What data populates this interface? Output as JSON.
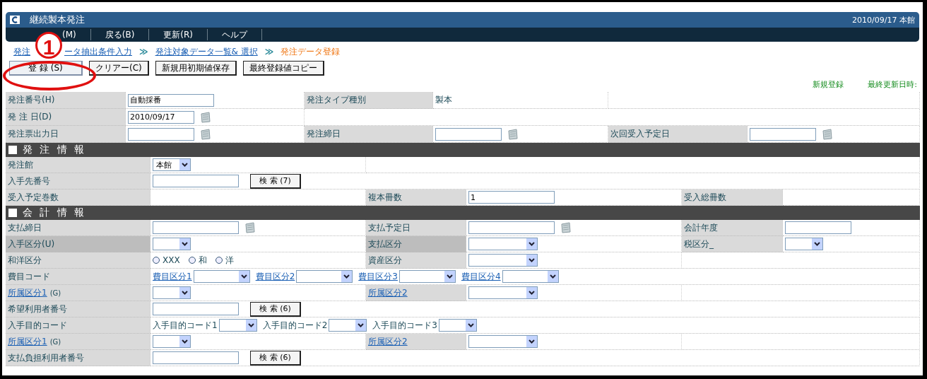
{
  "window": {
    "title": "継続製本発注",
    "info": "2010/09/17 本館"
  },
  "menu": [
    {
      "label": "(M)"
    },
    {
      "label": "戻る(B)"
    },
    {
      "label": "更新(R)"
    },
    {
      "label": "ヘルプ"
    }
  ],
  "breadcrumb": [
    {
      "parts": [
        "発注",
        "ータ抽出条件入力"
      ],
      "current": false
    },
    {
      "parts": [
        "発注対象データ一覧& 選択"
      ],
      "current": false
    },
    {
      "parts": [
        "発注データ登録"
      ],
      "current": true
    }
  ],
  "breadcrumb_separator": "≫",
  "actions": [
    "登 録 (S)",
    "クリアー(C)",
    "新規用初期値保存",
    "最終登録値コピー"
  ],
  "annotation": {
    "label": "1"
  },
  "status": [
    "新規登録",
    "最終更新日時:"
  ],
  "form": {
    "top_rows": [
      {
        "cells": [
          {
            "kind": "label",
            "text": "発注番号(H)",
            "highlight": false
          },
          {
            "kind": "value",
            "controls": [
              {
                "kind": "input",
                "value": "自動採番"
              }
            ]
          },
          {
            "kind": "label",
            "text": "発注タイプ種別",
            "highlight": false
          },
          {
            "kind": "value",
            "controls": [
              {
                "kind": "text",
                "text": "製本"
              }
            ]
          },
          {
            "kind": "value"
          }
        ]
      },
      {
        "cells": [
          {
            "kind": "label",
            "text": "発 注 日(D)",
            "highlight": false
          },
          {
            "kind": "value",
            "controls": [
              {
                "kind": "input",
                "value": "2010/09/17"
              },
              {
                "kind": "calendar"
              }
            ]
          },
          {
            "kind": "value"
          }
        ]
      },
      {
        "cells": [
          {
            "kind": "label",
            "text": "発注票出力日",
            "highlight": false
          },
          {
            "kind": "value",
            "controls": [
              {
                "kind": "input"
              },
              {
                "kind": "calendar"
              }
            ]
          },
          {
            "kind": "label",
            "text": "発注締日",
            "highlight": false
          },
          {
            "kind": "value",
            "controls": [
              {
                "kind": "input"
              },
              {
                "kind": "calendar"
              }
            ]
          },
          {
            "kind": "label",
            "text": "次回受入予定日",
            "highlight": false
          },
          {
            "kind": "value",
            "controls": [
              {
                "kind": "input"
              },
              {
                "kind": "calendar"
              }
            ]
          }
        ]
      }
    ],
    "sections": [
      {
        "title": "発 注 情 報",
        "rows": [
          {
            "cells": [
              {
                "kind": "label",
                "text": "発注館",
                "highlight": false
              },
              {
                "kind": "value",
                "controls": [
                  {
                    "kind": "select",
                    "value": "本館"
                  }
                ]
              },
              {
                "kind": "value"
              }
            ]
          },
          {
            "cells": [
              {
                "kind": "label",
                "text": "入手先番号",
                "highlight": false
              },
              {
                "kind": "value",
                "controls": [
                  {
                    "kind": "input"
                  },
                  {
                    "kind": "button",
                    "text": "検 索 (7)"
                  }
                ]
              }
            ]
          },
          {
            "cells": [
              {
                "kind": "label",
                "text": "受入予定巻数",
                "highlight": false
              },
              {
                "kind": "value"
              },
              {
                "kind": "label",
                "text": "複本冊数",
                "highlight": false
              },
              {
                "kind": "value",
                "controls": [
                  {
                    "kind": "input",
                    "value": "1"
                  }
                ]
              },
              {
                "kind": "label",
                "text": "受入総冊数",
                "highlight": false
              },
              {
                "kind": "value"
              }
            ]
          }
        ]
      },
      {
        "title": "会 計 情 報",
        "rows": [
          {
            "cells": [
              {
                "kind": "label",
                "text": "支払締日",
                "highlight": false
              },
              {
                "kind": "value",
                "controls": [
                  {
                    "kind": "input"
                  },
                  {
                    "kind": "calendar"
                  }
                ]
              },
              {
                "kind": "label",
                "text": "支払予定日",
                "highlight": false
              },
              {
                "kind": "value",
                "controls": [
                  {
                    "kind": "input"
                  },
                  {
                    "kind": "calendar"
                  }
                ]
              },
              {
                "kind": "label",
                "text": "会計年度",
                "highlight": false
              },
              {
                "kind": "value",
                "controls": [
                  {
                    "kind": "input"
                  }
                ]
              }
            ]
          },
          {
            "cells": [
              {
                "kind": "label",
                "text": "入手区分(U)",
                "highlight": true
              },
              {
                "kind": "value",
                "controls": [
                  {
                    "kind": "select"
                  }
                ]
              },
              {
                "kind": "label",
                "text": "支払区分",
                "highlight": true
              },
              {
                "kind": "value",
                "controls": [
                  {
                    "kind": "select"
                  }
                ]
              },
              {
                "kind": "label",
                "text": "税区分_",
                "highlight": false
              },
              {
                "kind": "value",
                "controls": [
                  {
                    "kind": "select"
                  }
                ]
              }
            ]
          },
          {
            "cells": [
              {
                "kind": "label",
                "text": "和洋区分",
                "highlight": false
              },
              {
                "kind": "value",
                "controls": [
                  {
                    "kind": "radio",
                    "text": "XXX",
                    "selected": false
                  },
                  {
                    "kind": "radio",
                    "text": "和",
                    "selected": false
                  },
                  {
                    "kind": "radio",
                    "text": "洋",
                    "selected": false
                  }
                ]
              },
              {
                "kind": "label",
                "text": "資産区分",
                "highlight": false
              },
              {
                "kind": "value",
                "controls": [
                  {
                    "kind": "select"
                  }
                ]
              },
              {
                "kind": "value"
              }
            ]
          },
          {
            "cells": [
              {
                "kind": "label",
                "text": "費目コード",
                "highlight": false
              },
              {
                "kind": "value",
                "controls": [
                  {
                    "kind": "link",
                    "text": "費目区分1"
                  },
                  {
                    "kind": "select"
                  },
                  {
                    "kind": "link",
                    "text": "費目区分2"
                  },
                  {
                    "kind": "select"
                  },
                  {
                    "kind": "link",
                    "text": "費目区分3"
                  },
                  {
                    "kind": "select"
                  },
                  {
                    "kind": "link",
                    "text": "費目区分4"
                  },
                  {
                    "kind": "select"
                  }
                ]
              }
            ]
          },
          {
            "cells": [
              {
                "kind": "label",
                "link": "所属区分1",
                "text": "(G)",
                "highlight": false
              },
              {
                "kind": "value",
                "controls": [
                  {
                    "kind": "select"
                  }
                ]
              },
              {
                "kind": "label",
                "link": "所属区分2",
                "highlight": false
              },
              {
                "kind": "value",
                "controls": [
                  {
                    "kind": "select"
                  }
                ]
              },
              {
                "kind": "value"
              }
            ]
          },
          {
            "cells": [
              {
                "kind": "label",
                "text": "希望利用者番号",
                "highlight": false
              },
              {
                "kind": "value",
                "controls": [
                  {
                    "kind": "input"
                  },
                  {
                    "kind": "button",
                    "text": "検 索 (6)"
                  }
                ]
              }
            ]
          },
          {
            "cells": [
              {
                "kind": "label",
                "text": "入手目的コード",
                "highlight": false
              },
              {
                "kind": "value",
                "controls": [
                  {
                    "kind": "text",
                    "text": "入手目的コード1"
                  },
                  {
                    "kind": "select"
                  },
                  {
                    "kind": "text",
                    "text": "入手目的コード2"
                  },
                  {
                    "kind": "select"
                  },
                  {
                    "kind": "text",
                    "text": "入手目的コード3"
                  },
                  {
                    "kind": "select"
                  }
                ]
              }
            ]
          },
          {
            "cells": [
              {
                "kind": "label",
                "link": "所属区分1",
                "text": "(G)",
                "highlight": false
              },
              {
                "kind": "value",
                "controls": [
                  {
                    "kind": "select"
                  }
                ]
              },
              {
                "kind": "label",
                "link": "所属区分2",
                "highlight": false
              },
              {
                "kind": "value",
                "controls": [
                  {
                    "kind": "select"
                  }
                ]
              },
              {
                "kind": "value"
              }
            ]
          },
          {
            "cells": [
              {
                "kind": "label",
                "text": "支払負担利用者番号",
                "highlight": false
              },
              {
                "kind": "value",
                "controls": [
                  {
                    "kind": "input"
                  },
                  {
                    "kind": "button",
                    "text": "検 索 (6)"
                  }
                ]
              }
            ]
          }
        ]
      }
    ]
  }
}
